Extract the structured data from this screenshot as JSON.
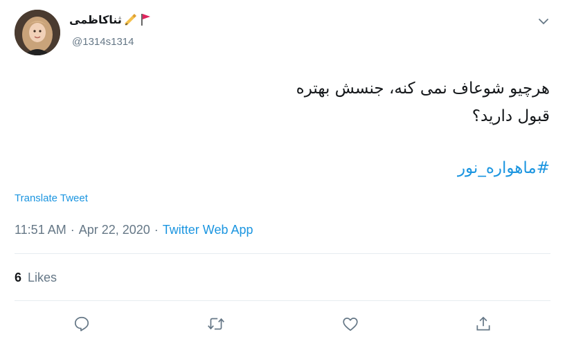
{
  "author": {
    "display_name": "ثناکاظمی",
    "name_emojis": [
      "writing-hand-icon",
      "red-flag-icon"
    ],
    "handle": "@1314s1314"
  },
  "tweet": {
    "lines": [
      "هرچیو شوعاف نمی کنه، جنسش بهتره",
      "قبول دارید؟"
    ],
    "hashtag": "#ماهواره_نور"
  },
  "translate_label": "Translate Tweet",
  "meta": {
    "time": "11:51 AM",
    "separator": "·",
    "date": "Apr 22, 2020",
    "source": "Twitter Web App"
  },
  "stats": {
    "likes_count": "6",
    "likes_label": "Likes"
  },
  "actions": [
    "reply-icon",
    "retweet-icon",
    "like-icon",
    "share-icon"
  ],
  "colors": {
    "accent": "#1b95e0",
    "secondary_text": "#657786",
    "primary_text": "#14171a",
    "divider": "#e6ecf0"
  }
}
